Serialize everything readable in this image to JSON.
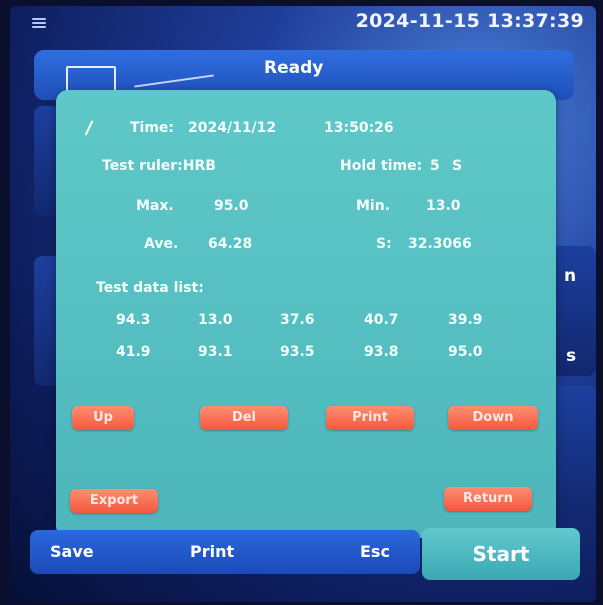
{
  "status_bar": {
    "datetime": "2024-11-15 13:37:39"
  },
  "header": {
    "status": "Ready"
  },
  "background_peek": {
    "right_top": "n",
    "right_bottom": "s"
  },
  "dialog": {
    "time_label": "Time:",
    "time_date": "2024/11/12",
    "time_clock": "13:50:26",
    "test_ruler": "Test ruler:HRB",
    "hold_time_label": "Hold time:",
    "hold_time_value": "5",
    "hold_time_unit": "S",
    "max_label": "Max.",
    "max_value": "95.0",
    "min_label": "Min.",
    "min_value": "13.0",
    "ave_label": "Ave.",
    "ave_value": "64.28",
    "s_label": "S:",
    "s_value": "32.3066",
    "list_title": "Test data list:",
    "data": [
      [
        "94.3",
        "13.0",
        "37.6",
        "40.7",
        "39.9"
      ],
      [
        "41.9",
        "93.1",
        "93.5",
        "93.8",
        "95.0"
      ]
    ],
    "buttons": {
      "up": "Up",
      "del": "Del",
      "print": "Print",
      "down": "Down",
      "export": "Export",
      "return": "Return"
    }
  },
  "bottom_bar": {
    "save": "Save",
    "print": "Print",
    "esc": "Esc",
    "start": "Start"
  },
  "colors": {
    "dialog": "#55bfc2",
    "button": "#f3593f",
    "panel": "#1f4fb8",
    "start": "#3aa8b4"
  }
}
